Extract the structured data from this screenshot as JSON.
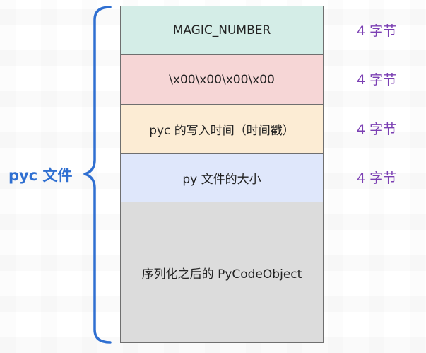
{
  "diagram": {
    "file_label": "pyc 文件",
    "blocks": [
      {
        "label": "MAGIC_NUMBER",
        "size": "4 字节"
      },
      {
        "label": "\\x00\\x00\\x00\\x00",
        "size": "4 字节"
      },
      {
        "label": "pyc 的写入时间（时间戳）",
        "size": "4 字节"
      },
      {
        "label": "py 文件的大小",
        "size": "4 字节"
      },
      {
        "label": "序列化之后的 PyCodeObject"
      }
    ],
    "colors": {
      "block1": "#d4ede7",
      "block2": "#f6d6d6",
      "block3": "#fcecd4",
      "block4": "#dfe7fb",
      "block5": "#dcdcdc",
      "brace": "#2f6fd1",
      "size_text": "#7b3fb3"
    }
  }
}
